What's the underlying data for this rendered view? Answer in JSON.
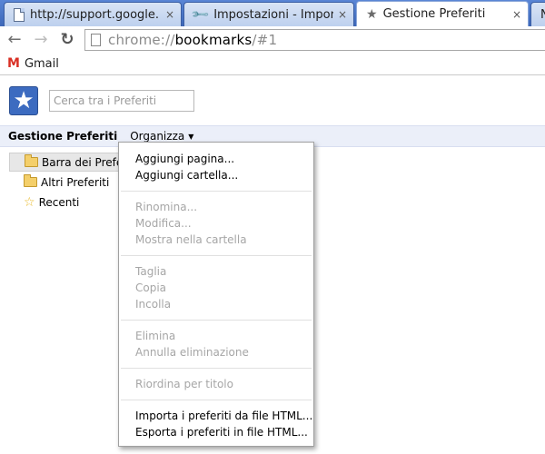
{
  "tabs": [
    {
      "title": "http://support.google.",
      "icon": "page-icon"
    },
    {
      "title": "Impostazioni - Importa",
      "icon": "wrench-icon"
    },
    {
      "title": "Gestione Preferiti",
      "icon": "star-icon",
      "active": true
    },
    {
      "title": "N",
      "icon": "page-icon"
    }
  ],
  "tab_close": "×",
  "toolbar": {
    "back": "←",
    "forward": "→",
    "reload": "↻",
    "url_scheme": "chrome://",
    "url_host": "bookmarks",
    "url_path": "/#1"
  },
  "bookmarks_bar": {
    "items": [
      {
        "label": "Gmail",
        "icon": "gmail-icon"
      }
    ]
  },
  "header": {
    "search_placeholder": "Cerca tra i Preferiti"
  },
  "manager": {
    "title": "Gestione Preferiti",
    "organize_label": "Organizza"
  },
  "tree": {
    "items": [
      {
        "label": "Barra dei Preferiti",
        "icon": "folder-icon",
        "selected": true
      },
      {
        "label": "Altri Preferiti",
        "icon": "folder-icon"
      },
      {
        "label": "Recenti",
        "icon": "star-icon"
      }
    ]
  },
  "menu": {
    "items": [
      {
        "label": "Aggiungi pagina...",
        "enabled": true
      },
      {
        "label": "Aggiungi cartella...",
        "enabled": true
      },
      {
        "separator": true
      },
      {
        "label": "Rinomina...",
        "enabled": false
      },
      {
        "label": "Modifica...",
        "enabled": false
      },
      {
        "label": "Mostra nella cartella",
        "enabled": false
      },
      {
        "separator": true
      },
      {
        "label": "Taglia",
        "enabled": false
      },
      {
        "label": "Copia",
        "enabled": false
      },
      {
        "label": "Incolla",
        "enabled": false
      },
      {
        "separator": true
      },
      {
        "label": "Elimina",
        "enabled": false
      },
      {
        "label": "Annulla eliminazione",
        "enabled": false
      },
      {
        "separator": true
      },
      {
        "label": "Riordina per titolo",
        "enabled": false
      },
      {
        "separator": true
      },
      {
        "label": "Importa i preferiti da file HTML...",
        "enabled": true
      },
      {
        "label": "Esporta i preferiti in file HTML...",
        "enabled": true
      }
    ]
  }
}
